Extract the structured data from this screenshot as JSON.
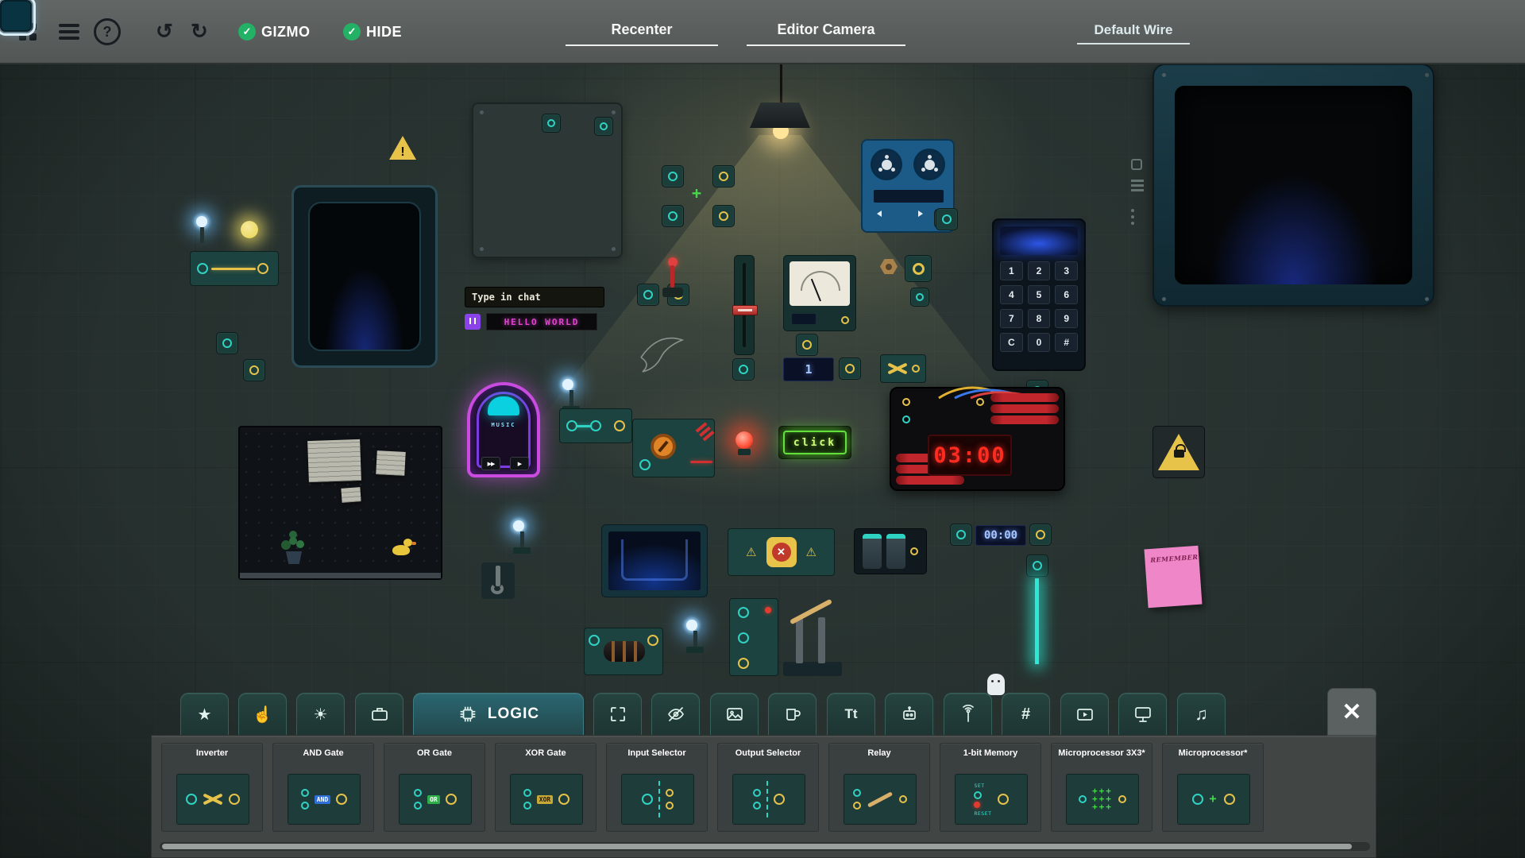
{
  "colors": {
    "accent_teal": "#2fd3c3",
    "accent_gold": "#e6c24a",
    "selection_blue": "#1b80c4"
  },
  "icons": {
    "help": "?",
    "undo": "↺",
    "redo": "↻",
    "check": "✓",
    "close": "✕",
    "star": "★",
    "hand": "☝",
    "sun": "☀",
    "hash": "#",
    "text": "Tt",
    "music": "♫",
    "play": "▶",
    "fast_forward": "▶▶",
    "rewind": "◀",
    "warning": "!",
    "warning_sign": "⚠",
    "chip_cross": "+"
  },
  "topbar": {
    "gizmo": "GIZMO",
    "hide": "HIDE",
    "recenter": "Recenter",
    "editor_camera": "Editor Camera",
    "wire_selector": "Default Wire",
    "swatches": [
      {
        "name": "blue",
        "css": "background:#1b80c4",
        "selected": true
      },
      {
        "name": "teal",
        "css": "background:#0cc795"
      },
      {
        "name": "yellow",
        "css": "background:#e8c34a"
      },
      {
        "name": "red",
        "css": "background:#e73a5e"
      },
      {
        "name": "orange",
        "css": "background:#ee8c4e"
      },
      {
        "name": "purple",
        "css": "background:#5c2da2"
      },
      {
        "name": "navy",
        "css": "background:#0a3341"
      }
    ]
  },
  "canvas": {
    "chat_sign": {
      "title": "Type in chat",
      "message": "HELLO WORLD"
    },
    "counter_one": "1",
    "bomb_timer": "03:00",
    "timer_display": "00:00",
    "click_label": "click",
    "sticky_note": "REMEMBER",
    "music_label": "MUSIC",
    "keypad": {
      "keys": [
        "1",
        "2",
        "3",
        "4",
        "5",
        "6",
        "7",
        "8",
        "9",
        "C",
        "0",
        "#"
      ]
    }
  },
  "tabs": {
    "selected": {
      "label": "LOGIC"
    },
    "names": [
      "favorites",
      "hand",
      "light",
      "tools",
      "logic",
      "frame",
      "hidden",
      "images",
      "props",
      "text",
      "robots",
      "signal",
      "numbers",
      "video",
      "screens",
      "audio"
    ]
  },
  "shelf": {
    "micro_row": "+++",
    "items": [
      {
        "label": "Inverter"
      },
      {
        "label": "AND Gate",
        "badge": "AND"
      },
      {
        "label": "OR Gate",
        "badge": "OR"
      },
      {
        "label": "XOR Gate",
        "badge": "XOR"
      },
      {
        "label": "Input Selector"
      },
      {
        "label": "Output Selector"
      },
      {
        "label": "Relay"
      },
      {
        "label": "1-bit Memory",
        "set_label": "SET",
        "reset_label": "RESET"
      },
      {
        "label": "Microprocessor 3X3*"
      },
      {
        "label": "Microprocessor*"
      }
    ]
  }
}
